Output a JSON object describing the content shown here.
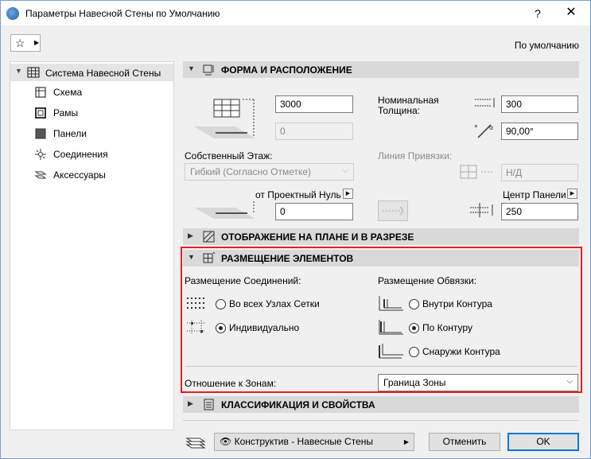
{
  "window": {
    "title": "Параметры Навесной Стены по Умолчанию",
    "help": "?",
    "close": "✕"
  },
  "header": {
    "favorites_icon": "star-icon",
    "default_label": "По умолчанию"
  },
  "sidebar": {
    "root": "Система Навесной Стены",
    "items": [
      {
        "label": "Схема",
        "icon": "scheme-icon"
      },
      {
        "label": "Рамы",
        "icon": "frames-icon"
      },
      {
        "label": "Панели",
        "icon": "panels-icon"
      },
      {
        "label": "Соединения",
        "icon": "junctions-icon"
      },
      {
        "label": "Аксессуары",
        "icon": "accessories-icon"
      }
    ]
  },
  "sections": {
    "shape": "ФОРМА И РАСПОЛОЖЕНИЕ",
    "display": "ОТОБРАЖЕНИЕ НА ПЛАНЕ И В РАЗРЕЗЕ",
    "placement": "РАЗМЕЩЕНИЕ ЭЛЕМЕНТОВ",
    "classification": "КЛАССИФИКАЦИЯ И СВОЙСТВА"
  },
  "shape": {
    "height_value": "3000",
    "offset_value": "0",
    "home_story_label": "Собственный Этаж:",
    "home_story_value": "Гибкий (Согласно Отметке)",
    "to_project_zero_label": "от Проектный Нуль",
    "base_value": "0",
    "nominal_thickness_label_1": "Номинальная",
    "nominal_thickness_label_2": "Толщина:",
    "thickness_value": "300",
    "angle_value": "90,00°",
    "ref_line_label": "Линия Привязки:",
    "ref_line_value": "Н/Д",
    "panel_center_label": "Центр Панели",
    "panel_center_value": "250"
  },
  "placement": {
    "junctions_label": "Размещение Соединений:",
    "junction_options": [
      "Во всех Узлах Сетки",
      "Индивидуально"
    ],
    "junction_selected": 1,
    "boundary_label": "Размещение Обвязки:",
    "boundary_options": [
      "Внутри Контура",
      "По Контуру",
      "Снаружи Контура"
    ],
    "boundary_selected": 1,
    "zones_label": "Отношение к Зонам:",
    "zones_value": "Граница Зоны"
  },
  "footer": {
    "layer_value": "Конструктив - Навесные Стены",
    "cancel": "Отменить",
    "ok": "OK"
  }
}
